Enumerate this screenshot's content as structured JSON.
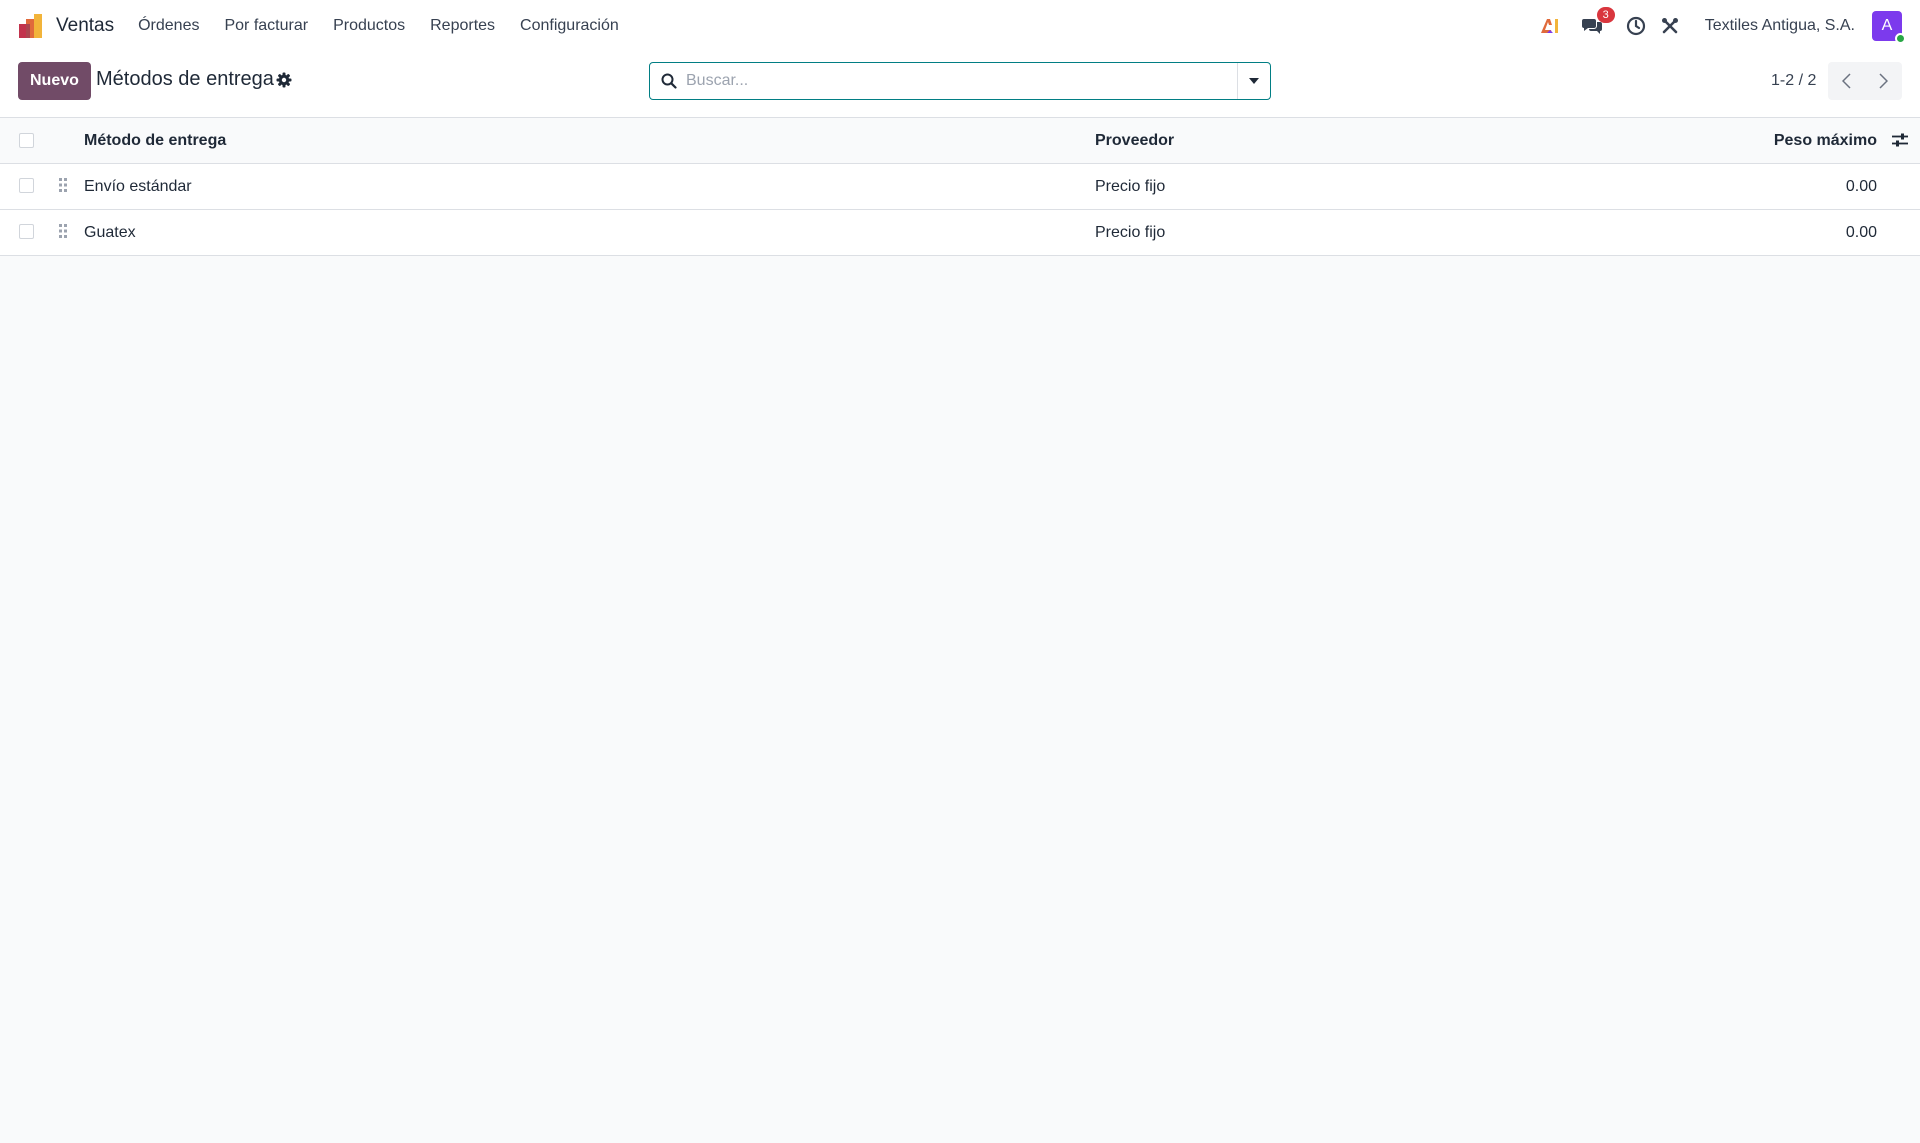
{
  "navbar": {
    "app_name": "Ventas",
    "menu": [
      "Órdenes",
      "Por facturar",
      "Productos",
      "Reportes",
      "Configuración"
    ],
    "messages_count": "3",
    "company": "Textiles Antigua, S.A.",
    "avatar_initial": "A"
  },
  "control_panel": {
    "new_button": "Nuevo",
    "title": "Métodos de entrega",
    "search_placeholder": "Buscar...",
    "pager_value": "1-2 / 2"
  },
  "table": {
    "columns": [
      "Método de entrega",
      "Proveedor",
      "Peso máximo"
    ],
    "rows": [
      {
        "name": "Envío estándar",
        "provider": "Precio fijo",
        "max_weight": "0.00"
      },
      {
        "name": "Guatex",
        "provider": "Precio fijo",
        "max_weight": "0.00"
      }
    ]
  },
  "colors": {
    "primary": "#714b67",
    "search_border": "#017e84",
    "badge": "#d9363e",
    "avatar": "#7c3aed",
    "presence": "#28a745"
  }
}
